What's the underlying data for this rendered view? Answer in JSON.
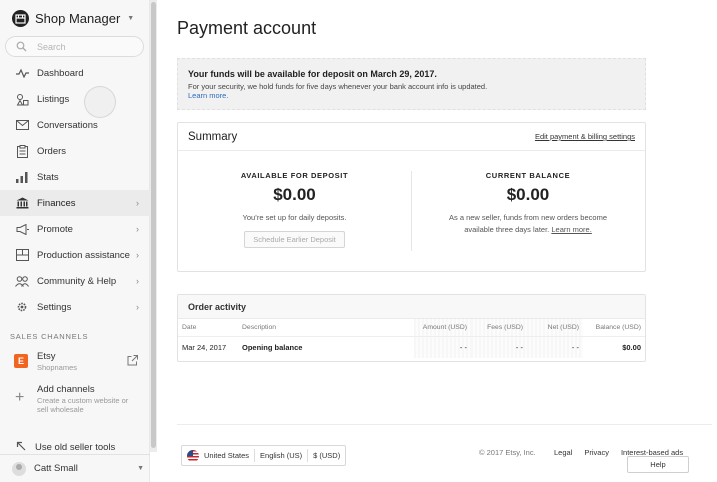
{
  "sidebar": {
    "brand_title": "Shop Manager",
    "search_placeholder": "Search",
    "items": [
      {
        "label": "Dashboard",
        "icon": "activity-icon",
        "chevron": false,
        "active": false
      },
      {
        "label": "Listings",
        "icon": "shapes-icon",
        "chevron": false,
        "active": false
      },
      {
        "label": "Conversations",
        "icon": "mail-icon",
        "chevron": false,
        "active": false
      },
      {
        "label": "Orders",
        "icon": "clipboard-icon",
        "chevron": false,
        "active": false
      },
      {
        "label": "Stats",
        "icon": "bar-chart-icon",
        "chevron": false,
        "active": false
      },
      {
        "label": "Finances",
        "icon": "bank-icon",
        "chevron": true,
        "active": true
      },
      {
        "label": "Promote",
        "icon": "megaphone-icon",
        "chevron": true,
        "active": false
      },
      {
        "label": "Production assistance",
        "icon": "factory-icon",
        "chevron": true,
        "active": false
      },
      {
        "label": "Community & Help",
        "icon": "people-icon",
        "chevron": true,
        "active": false
      },
      {
        "label": "Settings",
        "icon": "gear-icon",
        "chevron": true,
        "active": false
      }
    ],
    "channels_title": "SALES CHANNELS",
    "etsy_badge": "E",
    "etsy_name": "Etsy",
    "etsy_sub": "Shopnames",
    "add_channel_name": "Add channels",
    "add_channel_sub": "Create a custom website or sell wholesale",
    "old_tools_label": "Use old seller tools",
    "user_name": "Catt Small"
  },
  "main": {
    "title": "Payment account",
    "notice": {
      "title": "Your funds will be available for deposit on March 29, 2017.",
      "body": "For your security, we hold funds for five days whenever your bank account info is updated.",
      "link": "Learn more."
    },
    "summary": {
      "title": "Summary",
      "edit_link": "Edit payment & billing settings",
      "available_title": "AVAILABLE FOR DEPOSIT",
      "available_amount": "$0.00",
      "available_note": "You’re set up for daily deposits.",
      "schedule_button": "Schedule Earlier Deposit",
      "balance_title": "CURRENT BALANCE",
      "balance_amount": "$0.00",
      "balance_note": "As a new seller, funds from new orders become available three days later.",
      "balance_link": "Learn more."
    },
    "orders": {
      "title": "Order activity",
      "columns": [
        "Date",
        "Description",
        "Amount (USD)",
        "Fees (USD)",
        "Net (USD)",
        "Balance (USD)"
      ],
      "rows": [
        [
          "Mar 24, 2017",
          "Opening balance",
          "- -",
          "- -",
          "- -",
          "$0.00"
        ]
      ]
    }
  },
  "footer": {
    "country": "United States",
    "language": "English (US)",
    "currency": "$ (USD)",
    "copyright": "© 2017 Etsy, Inc.",
    "links": [
      "Legal",
      "Privacy",
      "Interest-based ads"
    ],
    "help": "Help"
  },
  "colors": {
    "etsy_orange": "#f16521",
    "link_blue": "#2a6bbf",
    "sidebar_bg": "#f7f7f7"
  }
}
